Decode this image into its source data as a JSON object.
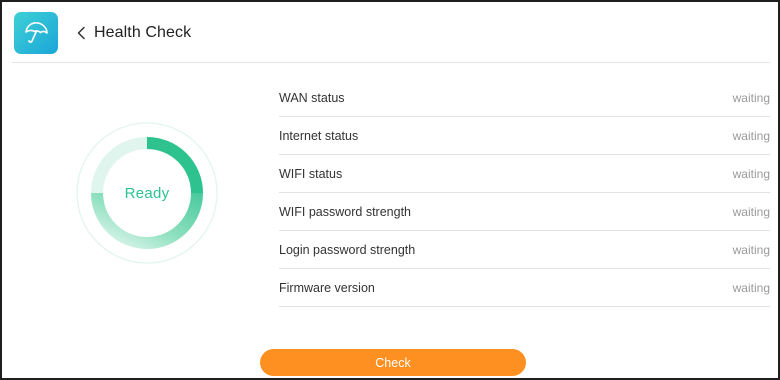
{
  "header": {
    "title": "Health Check",
    "app_icon": "umbrella-icon",
    "back_icon": "chevron-left-icon"
  },
  "status_ring": {
    "label": "Ready",
    "accent_color": "#2EC28E"
  },
  "status_items": [
    {
      "label": "WAN status",
      "value": "waiting"
    },
    {
      "label": "Internet status",
      "value": "waiting"
    },
    {
      "label": "WIFI status",
      "value": "waiting"
    },
    {
      "label": "WIFI password strength",
      "value": "waiting"
    },
    {
      "label": "Login password strength",
      "value": "waiting"
    },
    {
      "label": "Firmware version",
      "value": "waiting"
    }
  ],
  "actions": {
    "check_label": "Check",
    "check_color": "#FD9020"
  },
  "colors": {
    "app_icon_gradient_start": "#3FD0D6",
    "app_icon_gradient_end": "#1AA6D8"
  }
}
